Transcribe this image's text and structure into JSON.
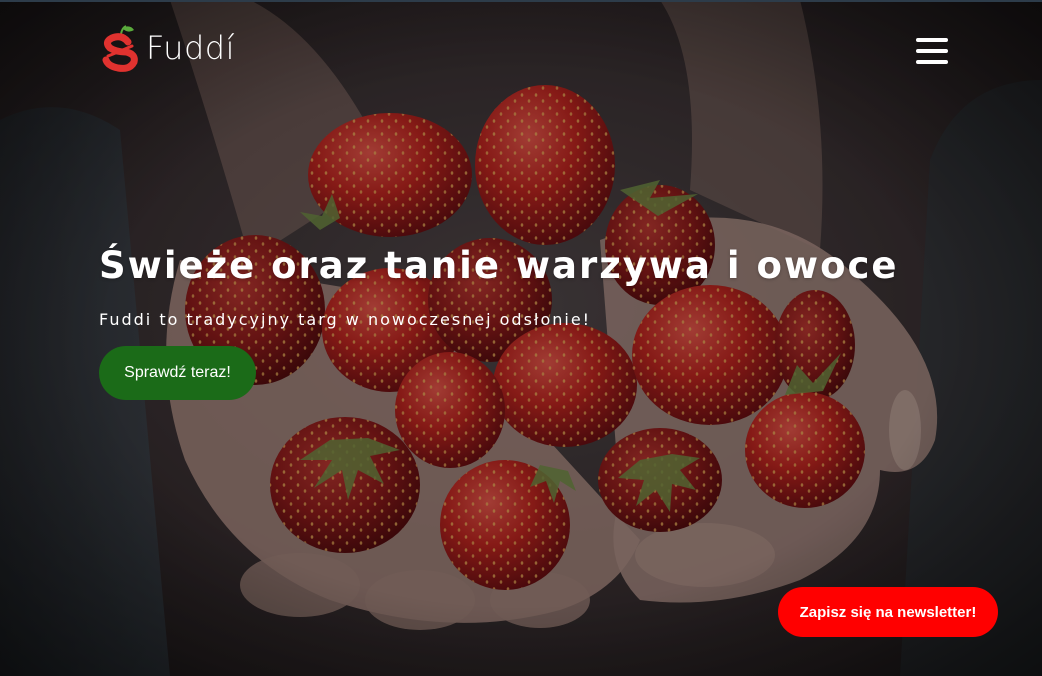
{
  "brand": {
    "name": "Fuddí",
    "colors": {
      "mark_red": "#e0322f",
      "mark_leaf": "#5aab3c"
    }
  },
  "header": {
    "menu_icon": "hamburger-menu-icon"
  },
  "hero": {
    "background_image": "strawberries-in-hands-photo",
    "title": "Świeże oraz tanie warzywa i owoce",
    "subtitle": "Fuddi to tradycyjny targ w nowoczesnej odsłonie!",
    "cta_label": "Sprawdź teraz!"
  },
  "newsletter": {
    "label": "Zapisz się na newsletter!"
  },
  "colors": {
    "cta_green": "#1b6b18",
    "newsletter_red": "#ff0000",
    "text_white": "#ffffff"
  }
}
